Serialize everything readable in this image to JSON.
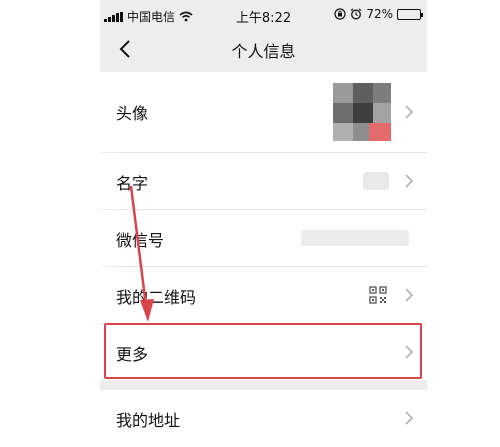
{
  "status_bar": {
    "carrier": "中国电信",
    "time": "上午8:22",
    "battery_text": "72%",
    "battery_level": 0.72
  },
  "nav": {
    "back_icon": "chevron-left-icon",
    "title": "个人信息"
  },
  "rows": {
    "avatar": {
      "label": "头像"
    },
    "name": {
      "label": "名字",
      "value": ""
    },
    "wechat_id": {
      "label": "微信号",
      "value": ""
    },
    "qr_code": {
      "label": "我的二维码",
      "icon": "qr-code-icon"
    },
    "more": {
      "label": "更多"
    },
    "address": {
      "label": "我的地址"
    }
  },
  "annotation": {
    "highlight_color": "#d9434a",
    "arrow_color": "#d9434a"
  }
}
